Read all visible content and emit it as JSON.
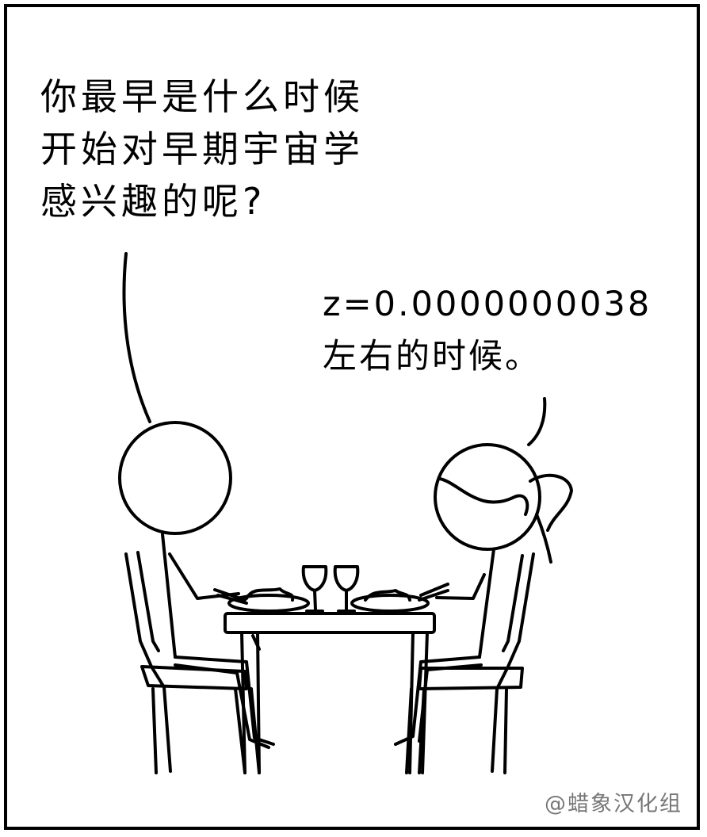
{
  "dialogue": {
    "left_speaker": "你最早是什么时候\n开始对早期宇宙学\n感兴趣的呢?",
    "right_speaker": "z=0.0000000038\n左右的时候。"
  },
  "credit": "@蜡象汉化组"
}
